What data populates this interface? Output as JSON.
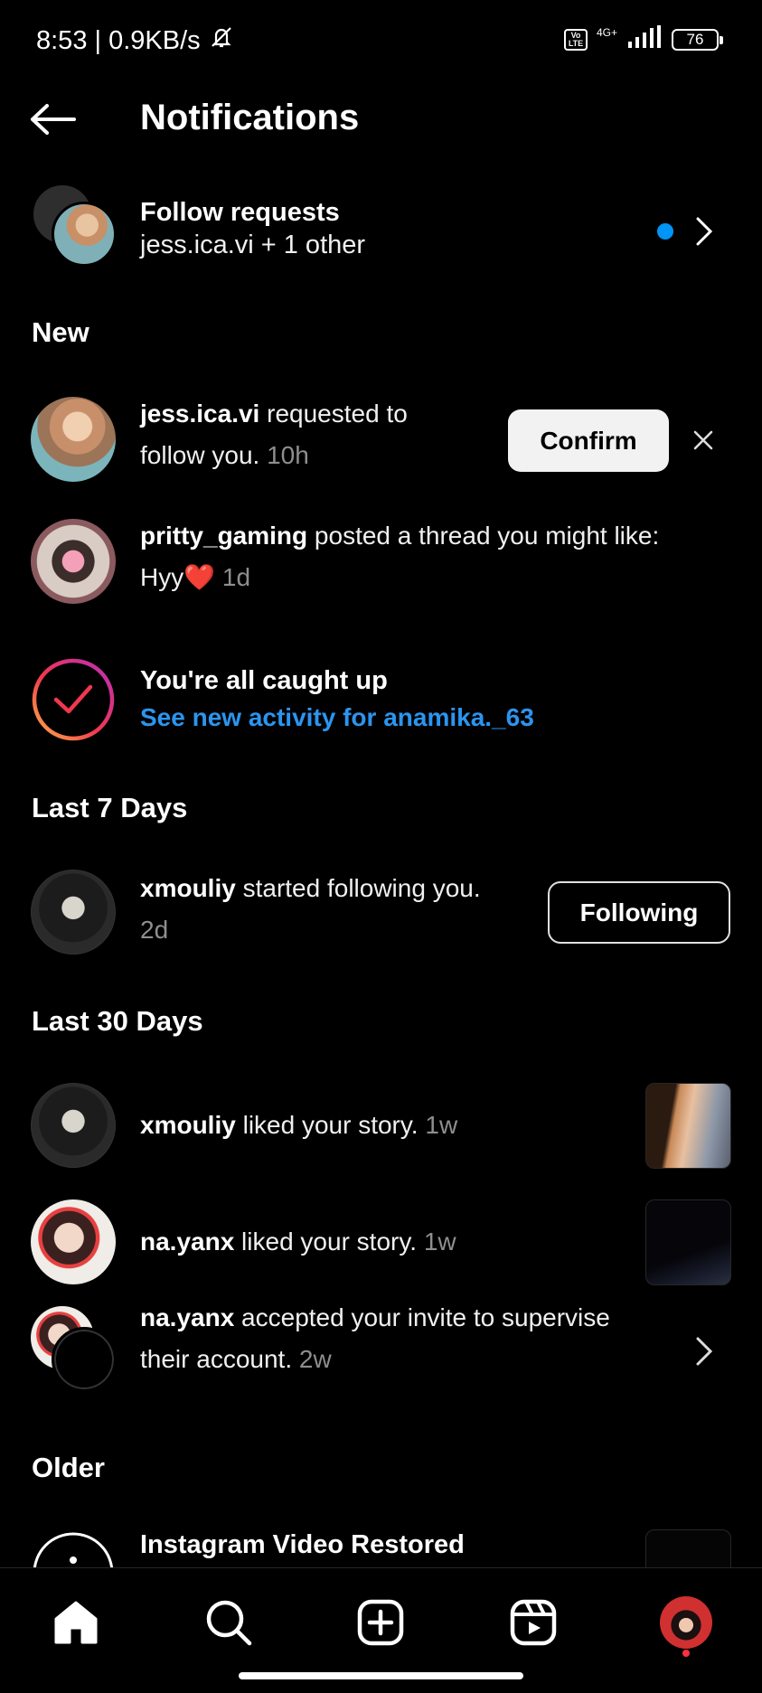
{
  "status_bar": {
    "time": "8:53 | 0.9KB/s",
    "volte": "Vo LTE",
    "network": "4G+",
    "battery": "76"
  },
  "header": {
    "title": "Notifications"
  },
  "follow_requests": {
    "title": "Follow requests",
    "subtitle": "jess.ica.vi + 1 other"
  },
  "sections": {
    "new": "New",
    "last7": "Last 7 Days",
    "last30": "Last 30 Days",
    "older": "Older"
  },
  "new_items": [
    {
      "user": "jess.ica.vi",
      "text_1": " requested to",
      "text_2": "follow you.",
      "time": "10h",
      "action": "Confirm"
    },
    {
      "user": "pritty_gaming",
      "text_1": " posted a thread you might like:",
      "text_2": "Hyy",
      "emoji": "❤️",
      "time": "1d"
    }
  ],
  "caught_up": {
    "title": "You're all caught up",
    "link": "See new activity for anamika._63"
  },
  "last7_items": [
    {
      "user": "xmouliy",
      "text": " started following you.",
      "time": "2d",
      "action": "Following"
    }
  ],
  "last30_items": [
    {
      "user": "xmouliy",
      "text": " liked your story.",
      "time": "1w"
    },
    {
      "user": "na.yanx",
      "text": " liked your story.",
      "time": "1w"
    },
    {
      "user": "na.yanx",
      "text_1": " accepted your invite to supervise",
      "text_2": "their account.",
      "time": "2w"
    }
  ],
  "older_items": [
    {
      "title": "Instagram Video Restored"
    }
  ],
  "colors": {
    "accent_blue": "#2b95f0",
    "unread_dot": "#0095f6",
    "background": "#000000"
  }
}
